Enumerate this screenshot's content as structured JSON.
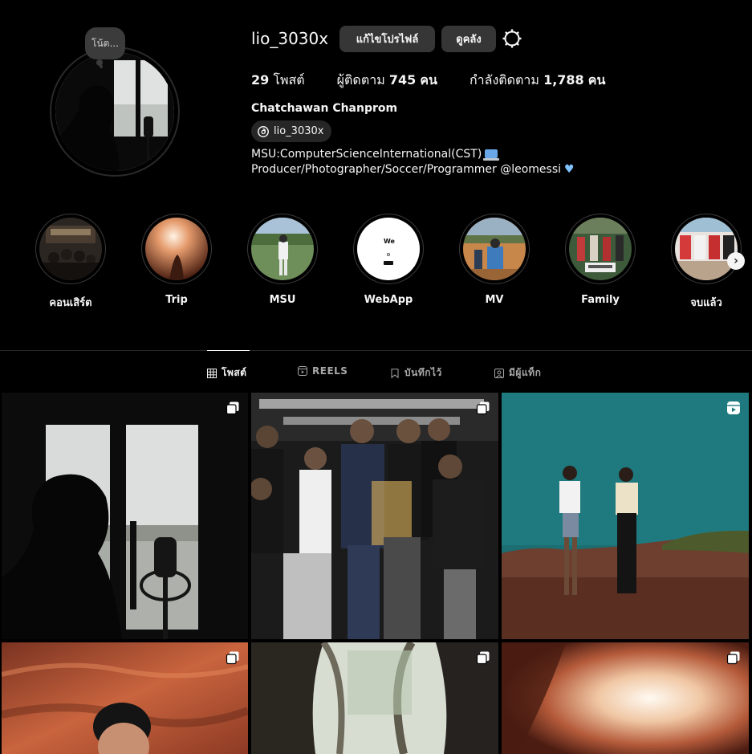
{
  "profile": {
    "username": "lio_3030x",
    "edit_label": "แก้ไขโปรไฟล์",
    "archive_label": "ดูคลัง",
    "note": "โน้ต...",
    "stats": {
      "posts": "29",
      "posts_label": "โพสต์",
      "followers_prefix": "ผู้ติดตาม",
      "followers": "745",
      "followers_suffix": "คน",
      "following_prefix": "กำลังติดตาม",
      "following": "1,788",
      "following_suffix": "คน"
    },
    "full_name": "Chatchawan Chanprom",
    "threads_handle": "lio_3030x",
    "bio_line1": "MSU:ComputerScienceInternational(CST)",
    "bio_line2": "Producer/Photographer/Soccer/Programmer @leomessi"
  },
  "highlights": [
    {
      "label": "คอนเสิร์ต"
    },
    {
      "label": "Trip"
    },
    {
      "label": "MSU"
    },
    {
      "label": "WebApp",
      "inner_text": "We"
    },
    {
      "label": "MV"
    },
    {
      "label": "Family"
    },
    {
      "label": "จบแล้ว"
    }
  ],
  "tabs": [
    {
      "label": "โพสต์",
      "icon": "grid-icon",
      "active": true
    },
    {
      "label": "REELS",
      "icon": "reels-icon",
      "active": false
    },
    {
      "label": "บันทึกไว้",
      "icon": "bookmark-icon",
      "active": false
    },
    {
      "label": "มีผู้แท็ก",
      "icon": "tagged-icon",
      "active": false
    }
  ],
  "posts": [
    {
      "type": "carousel",
      "scene": "silhouette-microphone"
    },
    {
      "type": "carousel",
      "scene": "group-photo-banner"
    },
    {
      "type": "reel",
      "scene": "two-friends-hilltop"
    },
    {
      "type": "carousel",
      "scene": "portrait-red-rock"
    },
    {
      "type": "carousel",
      "scene": "forest-trunk"
    },
    {
      "type": "carousel",
      "scene": "cave-light"
    }
  ],
  "colors": {
    "background": "#000000",
    "button": "#363636",
    "text": "#f5f5f5",
    "muted": "#a8a8a8"
  }
}
